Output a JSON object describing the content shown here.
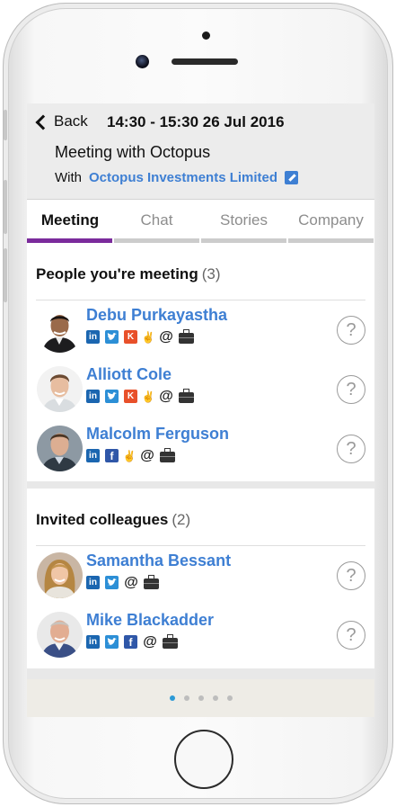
{
  "header": {
    "back_label": "Back",
    "time": "14:30 - 15:30 26 Jul 2016",
    "title": "Meeting with Octopus",
    "with_label": "With",
    "company": "Octopus Investments Limited"
  },
  "tabs": [
    {
      "label": "Meeting",
      "active": true
    },
    {
      "label": "Chat"
    },
    {
      "label": "Stories"
    },
    {
      "label": "Company"
    }
  ],
  "meeting_section": {
    "title": "People you're meeting",
    "count": "(3)",
    "people": [
      {
        "name": "Debu Purkayastha",
        "icons": [
          "linkedin-icon",
          "twitter-icon",
          "klout-icon",
          "angellist-icon",
          "email-icon",
          "briefcase-icon"
        ]
      },
      {
        "name": "Alliott Cole",
        "icons": [
          "linkedin-icon",
          "twitter-icon",
          "klout-icon",
          "angellist-icon",
          "email-icon",
          "briefcase-icon"
        ]
      },
      {
        "name": "Malcolm Ferguson",
        "icons": [
          "linkedin-icon",
          "facebook-icon",
          "angellist-icon",
          "email-icon",
          "briefcase-icon"
        ]
      }
    ]
  },
  "colleagues_section": {
    "title": "Invited colleagues",
    "count": "(2)",
    "people": [
      {
        "name": "Samantha Bessant",
        "icons": [
          "linkedin-icon",
          "twitter-icon",
          "email-icon",
          "briefcase-icon"
        ]
      },
      {
        "name": "Mike Blackadder",
        "icons": [
          "linkedin-icon",
          "twitter-icon",
          "facebook-icon",
          "email-icon",
          "briefcase-icon"
        ]
      }
    ]
  },
  "icon_glyphs": {
    "linkedin": "in",
    "twitter": "🐦",
    "klout": "K",
    "facebook": "f",
    "angellist": "✌",
    "email": "@",
    "help": "?"
  },
  "pager": {
    "pages": 5,
    "active": 1
  },
  "colors": {
    "accent": "#7b2b9c",
    "link": "#3e7fd3",
    "pager_active": "#2d9ad6"
  }
}
